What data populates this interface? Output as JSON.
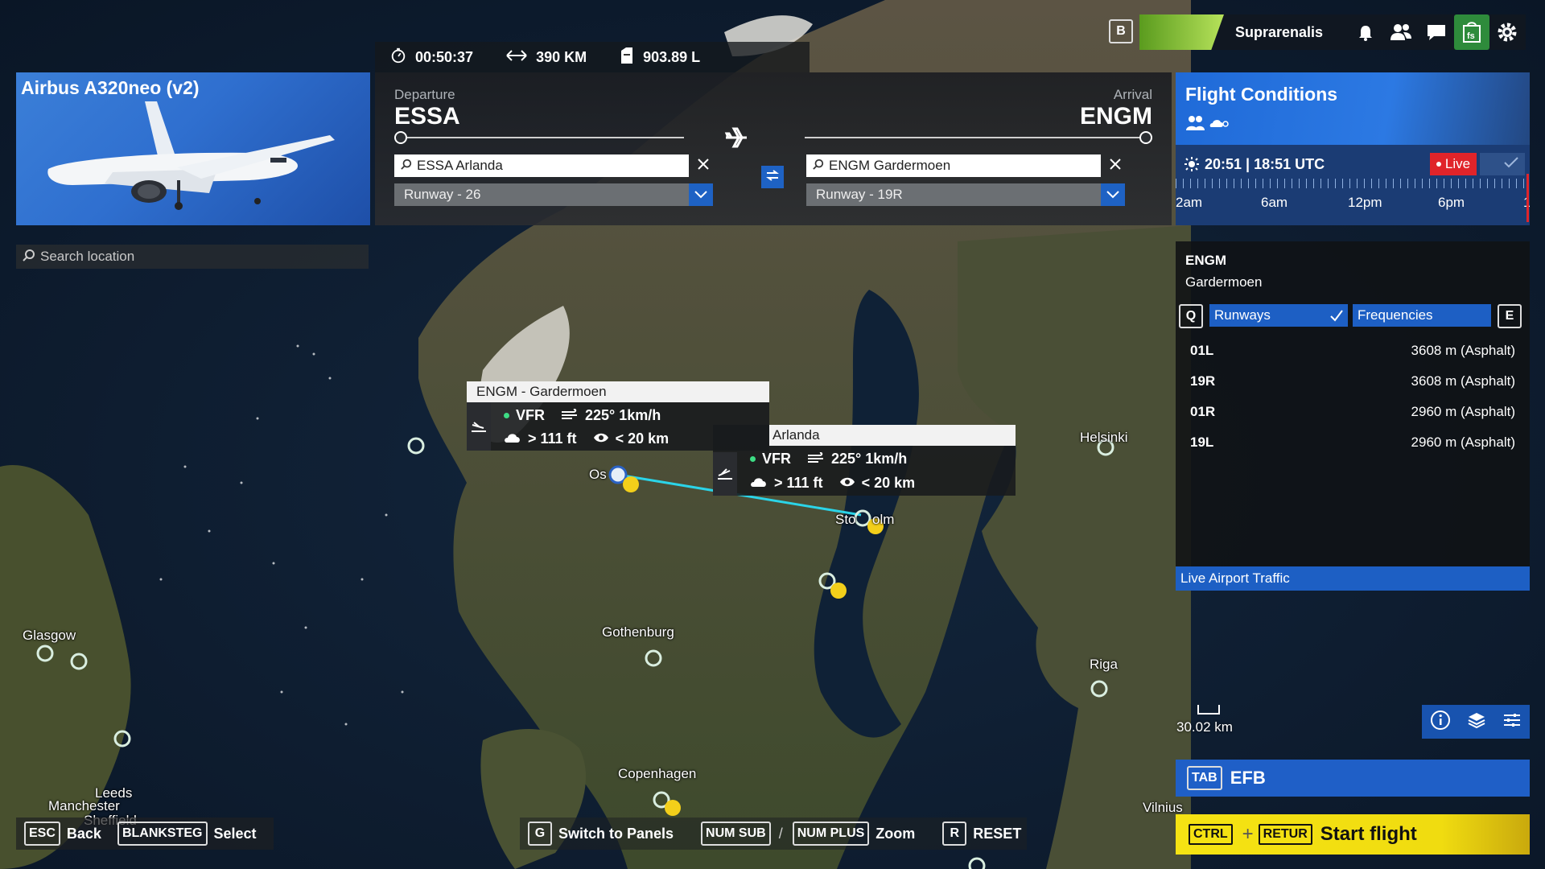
{
  "topbar": {
    "timer": "00:50:37",
    "distance": "390 KM",
    "fuel": "903.89 L"
  },
  "user": {
    "badge": "B",
    "name": "Suprarenalis",
    "icons": [
      "bell-icon",
      "friends-icon",
      "chat-icon",
      "fs-marketplace-icon",
      "settings-icon"
    ]
  },
  "aircraft": {
    "name": "Airbus A320neo (v2)"
  },
  "search": {
    "placeholder": "Search location"
  },
  "route": {
    "departure_label": "Departure",
    "departure_code": "ESSA",
    "departure_field": "ESSA Arlanda",
    "departure_runway": "Runway - 26",
    "arrival_label": "Arrival",
    "arrival_code": "ENGM",
    "arrival_field": "ENGM Gardermoen",
    "arrival_runway": "Runway - 19R"
  },
  "conditions": {
    "title": "Flight Conditions",
    "time": "20:51 | 18:51 UTC",
    "live": "Live",
    "timeline": [
      "2am",
      "6am",
      "12pm",
      "6pm",
      "1"
    ]
  },
  "airport_panel": {
    "code": "ENGM",
    "name": "Gardermoen",
    "key_left": "Q",
    "key_right": "E",
    "tab_runways": "Runways",
    "tab_frequencies": "Frequencies",
    "runways": [
      {
        "id": "01L",
        "info": "3608 m (Asphalt)"
      },
      {
        "id": "19R",
        "info": "3608 m (Asphalt)"
      },
      {
        "id": "01R",
        "info": "2960 m (Asphalt)"
      },
      {
        "id": "19L",
        "info": "2960 m (Asphalt)"
      }
    ],
    "traffic": "Live Airport Traffic"
  },
  "tooltips": {
    "gardermoen": {
      "title": "ENGM - Gardermoen",
      "rules": "VFR",
      "wind": "225° 1km/h",
      "ceiling": "> 111 ft",
      "visibility": "< 20 km"
    },
    "arlanda": {
      "title": "Arlanda",
      "rules": "VFR",
      "wind": "225° 1km/h",
      "ceiling": "> 111 ft",
      "visibility": "< 20 km"
    }
  },
  "map": {
    "scale": "30.02 km",
    "cities": [
      "Glasgow",
      "Leeds",
      "Manchester",
      "Sheffield",
      "Gothenburg",
      "Copenhagen",
      "Helsinki",
      "Riga",
      "Vilnius",
      "Os",
      "Sto",
      "olm"
    ]
  },
  "efb": {
    "key": "TAB",
    "label": "EFB"
  },
  "start": {
    "key1": "CTRL",
    "plus": "+",
    "key2": "RETUR",
    "label": "Start flight"
  },
  "bottom": {
    "esc_key": "ESC",
    "esc_label": "Back",
    "sel_key": "BLANKSTEG",
    "sel_label": "Select",
    "g_key": "G",
    "g_label": "Switch to Panels",
    "sub_key": "NUM SUB",
    "slash": "/",
    "plus_key": "NUM PLUS",
    "zoom_label": "Zoom",
    "r_key": "R",
    "r_label": "RESET"
  },
  "colors": {
    "accent": "#1f5fc7",
    "route_line": "#2bd4e8",
    "start": "#f5e313",
    "live": "#e0242a"
  }
}
